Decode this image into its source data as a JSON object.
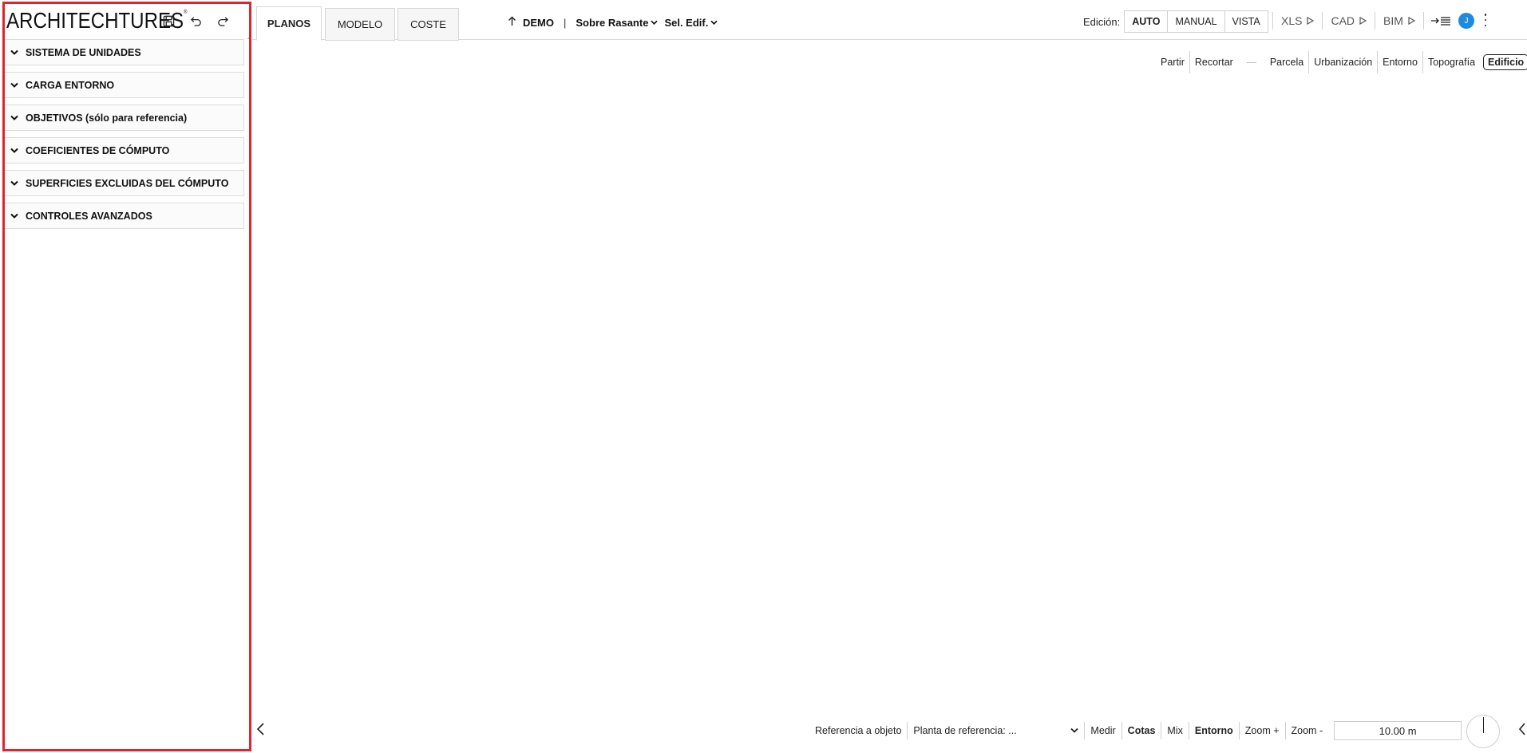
{
  "brand": {
    "name": "ARCHITECHTURES",
    "mark": "®"
  },
  "sidebar": {
    "sections": [
      {
        "label": "SISTEMA DE UNIDADES"
      },
      {
        "label": "CARGA ENTORNO"
      },
      {
        "label": "OBJETIVOS (sólo para referencia)"
      },
      {
        "label": "COEFICIENTES DE CÓMPUTO"
      },
      {
        "label": "SUPERFICIES EXCLUIDAS DEL CÓMPUTO"
      },
      {
        "label": "CONTROLES AVANZADOS"
      }
    ]
  },
  "tabs": [
    {
      "label": "PLANOS",
      "active": true
    },
    {
      "label": "MODELO",
      "active": false
    },
    {
      "label": "COSTE",
      "active": false
    }
  ],
  "project": {
    "name": "DEMO",
    "separator": "|",
    "level": "Sobre Rasante",
    "building": "Sel. Edif."
  },
  "edicion": {
    "label": "Edición:",
    "modes": [
      "AUTO",
      "MANUAL",
      "VISTA"
    ],
    "active": "AUTO"
  },
  "exports": [
    "XLS",
    "CAD",
    "BIM"
  ],
  "user": {
    "initial": "J",
    "color": "#1f8be0"
  },
  "layerbar": {
    "tools": [
      "Partir",
      "Recortar"
    ],
    "divider": "—",
    "layers": [
      "Parcela",
      "Urbanización",
      "Entorno",
      "Topografía"
    ],
    "selected": "Edificio"
  },
  "bottombar": {
    "reference": "Referencia a objeto",
    "planta_label": "Planta de referencia:",
    "planta_value": "...",
    "tools": [
      "Medir",
      "Cotas",
      "Mix",
      "Entorno",
      "Zoom +",
      "Zoom -"
    ],
    "bold_tools": [
      "Cotas",
      "Entorno"
    ],
    "scale": "10.00 m"
  },
  "colors": {
    "accent": "#e0242e",
    "avatar": "#1f8be0"
  }
}
